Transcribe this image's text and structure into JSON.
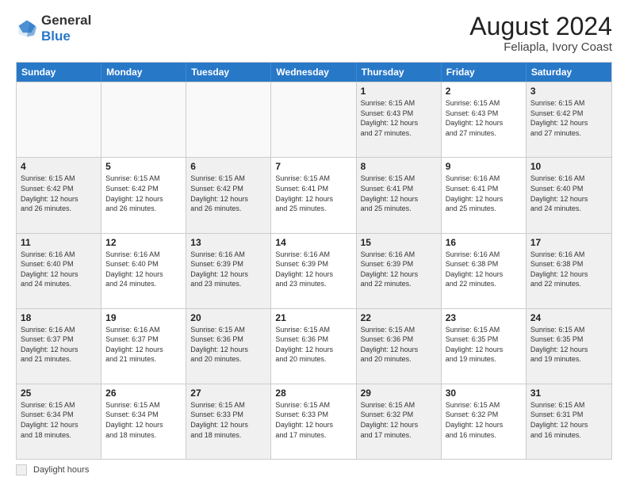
{
  "header": {
    "logo_line1": "General",
    "logo_line2": "Blue",
    "main_title": "August 2024",
    "subtitle": "Feliapla, Ivory Coast"
  },
  "days_of_week": [
    "Sunday",
    "Monday",
    "Tuesday",
    "Wednesday",
    "Thursday",
    "Friday",
    "Saturday"
  ],
  "footer_label": "Daylight hours",
  "weeks": [
    [
      {
        "day": "",
        "info": "",
        "empty": true
      },
      {
        "day": "",
        "info": "",
        "empty": true
      },
      {
        "day": "",
        "info": "",
        "empty": true
      },
      {
        "day": "",
        "info": "",
        "empty": true
      },
      {
        "day": "1",
        "info": "Sunrise: 6:15 AM\nSunset: 6:43 PM\nDaylight: 12 hours\nand 27 minutes.",
        "empty": false
      },
      {
        "day": "2",
        "info": "Sunrise: 6:15 AM\nSunset: 6:43 PM\nDaylight: 12 hours\nand 27 minutes.",
        "empty": false
      },
      {
        "day": "3",
        "info": "Sunrise: 6:15 AM\nSunset: 6:42 PM\nDaylight: 12 hours\nand 27 minutes.",
        "empty": false
      }
    ],
    [
      {
        "day": "4",
        "info": "Sunrise: 6:15 AM\nSunset: 6:42 PM\nDaylight: 12 hours\nand 26 minutes.",
        "empty": false
      },
      {
        "day": "5",
        "info": "Sunrise: 6:15 AM\nSunset: 6:42 PM\nDaylight: 12 hours\nand 26 minutes.",
        "empty": false
      },
      {
        "day": "6",
        "info": "Sunrise: 6:15 AM\nSunset: 6:42 PM\nDaylight: 12 hours\nand 26 minutes.",
        "empty": false
      },
      {
        "day": "7",
        "info": "Sunrise: 6:15 AM\nSunset: 6:41 PM\nDaylight: 12 hours\nand 25 minutes.",
        "empty": false
      },
      {
        "day": "8",
        "info": "Sunrise: 6:15 AM\nSunset: 6:41 PM\nDaylight: 12 hours\nand 25 minutes.",
        "empty": false
      },
      {
        "day": "9",
        "info": "Sunrise: 6:16 AM\nSunset: 6:41 PM\nDaylight: 12 hours\nand 25 minutes.",
        "empty": false
      },
      {
        "day": "10",
        "info": "Sunrise: 6:16 AM\nSunset: 6:40 PM\nDaylight: 12 hours\nand 24 minutes.",
        "empty": false
      }
    ],
    [
      {
        "day": "11",
        "info": "Sunrise: 6:16 AM\nSunset: 6:40 PM\nDaylight: 12 hours\nand 24 minutes.",
        "empty": false
      },
      {
        "day": "12",
        "info": "Sunrise: 6:16 AM\nSunset: 6:40 PM\nDaylight: 12 hours\nand 24 minutes.",
        "empty": false
      },
      {
        "day": "13",
        "info": "Sunrise: 6:16 AM\nSunset: 6:39 PM\nDaylight: 12 hours\nand 23 minutes.",
        "empty": false
      },
      {
        "day": "14",
        "info": "Sunrise: 6:16 AM\nSunset: 6:39 PM\nDaylight: 12 hours\nand 23 minutes.",
        "empty": false
      },
      {
        "day": "15",
        "info": "Sunrise: 6:16 AM\nSunset: 6:39 PM\nDaylight: 12 hours\nand 22 minutes.",
        "empty": false
      },
      {
        "day": "16",
        "info": "Sunrise: 6:16 AM\nSunset: 6:38 PM\nDaylight: 12 hours\nand 22 minutes.",
        "empty": false
      },
      {
        "day": "17",
        "info": "Sunrise: 6:16 AM\nSunset: 6:38 PM\nDaylight: 12 hours\nand 22 minutes.",
        "empty": false
      }
    ],
    [
      {
        "day": "18",
        "info": "Sunrise: 6:16 AM\nSunset: 6:37 PM\nDaylight: 12 hours\nand 21 minutes.",
        "empty": false
      },
      {
        "day": "19",
        "info": "Sunrise: 6:16 AM\nSunset: 6:37 PM\nDaylight: 12 hours\nand 21 minutes.",
        "empty": false
      },
      {
        "day": "20",
        "info": "Sunrise: 6:15 AM\nSunset: 6:36 PM\nDaylight: 12 hours\nand 20 minutes.",
        "empty": false
      },
      {
        "day": "21",
        "info": "Sunrise: 6:15 AM\nSunset: 6:36 PM\nDaylight: 12 hours\nand 20 minutes.",
        "empty": false
      },
      {
        "day": "22",
        "info": "Sunrise: 6:15 AM\nSunset: 6:36 PM\nDaylight: 12 hours\nand 20 minutes.",
        "empty": false
      },
      {
        "day": "23",
        "info": "Sunrise: 6:15 AM\nSunset: 6:35 PM\nDaylight: 12 hours\nand 19 minutes.",
        "empty": false
      },
      {
        "day": "24",
        "info": "Sunrise: 6:15 AM\nSunset: 6:35 PM\nDaylight: 12 hours\nand 19 minutes.",
        "empty": false
      }
    ],
    [
      {
        "day": "25",
        "info": "Sunrise: 6:15 AM\nSunset: 6:34 PM\nDaylight: 12 hours\nand 18 minutes.",
        "empty": false
      },
      {
        "day": "26",
        "info": "Sunrise: 6:15 AM\nSunset: 6:34 PM\nDaylight: 12 hours\nand 18 minutes.",
        "empty": false
      },
      {
        "day": "27",
        "info": "Sunrise: 6:15 AM\nSunset: 6:33 PM\nDaylight: 12 hours\nand 18 minutes.",
        "empty": false
      },
      {
        "day": "28",
        "info": "Sunrise: 6:15 AM\nSunset: 6:33 PM\nDaylight: 12 hours\nand 17 minutes.",
        "empty": false
      },
      {
        "day": "29",
        "info": "Sunrise: 6:15 AM\nSunset: 6:32 PM\nDaylight: 12 hours\nand 17 minutes.",
        "empty": false
      },
      {
        "day": "30",
        "info": "Sunrise: 6:15 AM\nSunset: 6:32 PM\nDaylight: 12 hours\nand 16 minutes.",
        "empty": false
      },
      {
        "day": "31",
        "info": "Sunrise: 6:15 AM\nSunset: 6:31 PM\nDaylight: 12 hours\nand 16 minutes.",
        "empty": false
      }
    ]
  ]
}
